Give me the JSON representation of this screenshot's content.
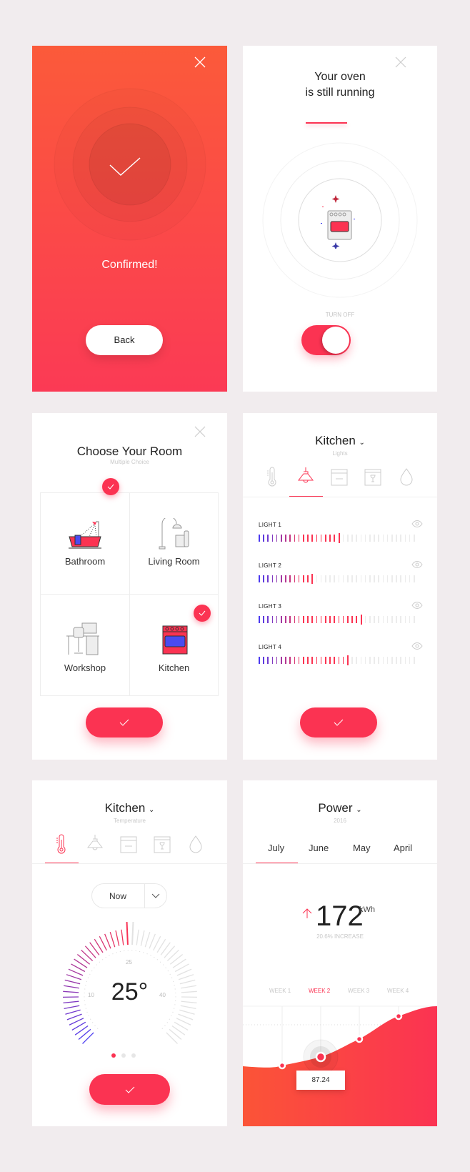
{
  "colors": {
    "accent": "#fb3352",
    "orange": "#fb5a3a",
    "blue": "#4b3bf0",
    "background": "#f1ecee"
  },
  "confirm_card": {
    "status": "Confirmed!",
    "back_label": "Back",
    "icons": [
      "close-icon",
      "checkmark-icon"
    ]
  },
  "oven_card": {
    "title_line1": "Your oven",
    "title_line2": "is still running",
    "toggle_label": "TURN OFF",
    "toggle_on": true,
    "icons": [
      "close-icon",
      "oven-icon"
    ]
  },
  "room_card": {
    "title": "Choose Your Room",
    "subtitle": "Multiple Choice",
    "rooms": [
      {
        "label": "Bathroom",
        "selected": true,
        "icon": "bathtub-icon"
      },
      {
        "label": "Living Room",
        "selected": false,
        "icon": "floor-lamp-icon"
      },
      {
        "label": "Workshop",
        "selected": false,
        "icon": "desk-icon"
      },
      {
        "label": "Kitchen",
        "selected": true,
        "icon": "oven-icon"
      }
    ]
  },
  "lights_card": {
    "title": "Kitchen",
    "subtitle": "Lights",
    "active_tab": 1,
    "tabs": [
      "thermometer-icon",
      "lamp-icon",
      "oven-icon",
      "dishwasher-icon",
      "water-drop-icon"
    ],
    "lights": [
      {
        "label": "LIGHT 1",
        "level": 0.5
      },
      {
        "label": "LIGHT 2",
        "level": 0.32
      },
      {
        "label": "LIGHT 3",
        "level": 0.64
      },
      {
        "label": "LIGHT 4",
        "level": 0.56
      }
    ]
  },
  "temp_card": {
    "title": "Kitchen",
    "subtitle": "Temperature",
    "active_tab": 0,
    "dropdown_value": "Now",
    "value": "25°",
    "current": 25,
    "scale_min": -5,
    "scale_max": 55,
    "tick_labels": [
      "10",
      "25",
      "40"
    ],
    "page": 1,
    "pages": 3
  },
  "power_card": {
    "title": "Power",
    "subtitle": "2016",
    "tabs": [
      "July",
      "June",
      "May",
      "April"
    ],
    "active_tab": 0,
    "value": "172",
    "unit": "kWh",
    "change": "20.6% INCREASE",
    "weeks": [
      "WEEK 1",
      "WEEK 2",
      "WEEK 3",
      "WEEK 4"
    ],
    "active_week": 1,
    "tooltip": "87.24"
  }
}
